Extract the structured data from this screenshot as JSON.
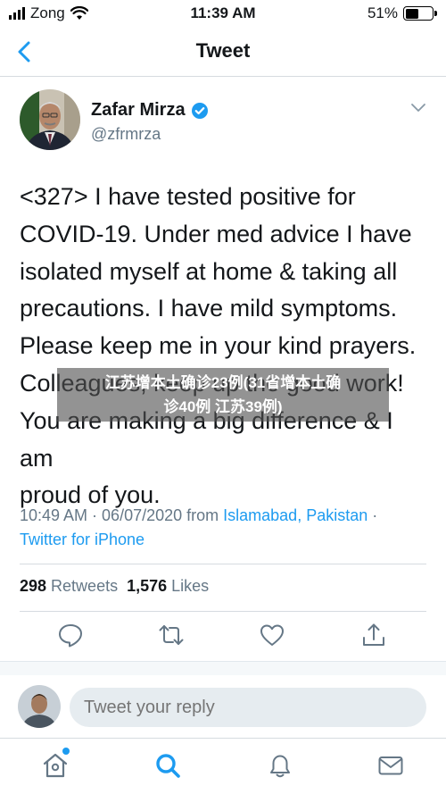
{
  "status_bar": {
    "carrier": "Zong",
    "time": "11:39 AM",
    "battery_percent": "51%",
    "battery_level": 0.51
  },
  "nav": {
    "title": "Tweet"
  },
  "author": {
    "name": "Zafar Mirza",
    "handle": "@zfrmrza",
    "verified": true
  },
  "tweet": {
    "text": "<327> I have tested positive for\nCOVID-19. Under med advice I have\nisolated myself at home & taking all\nprecautions. I have mild symptoms.\nPlease keep me in your kind prayers.\nColleagues, keep up the good work!\nYou are making a big difference & I am\nproud of you.",
    "timestamp": "10:49 AM · 06/07/2020 from ",
    "location": "Islamabad, Pakistan",
    "separator": " ·",
    "source": "Twitter for iPhone"
  },
  "overlay": {
    "line1": "江苏增本土确诊23例(31省增本土确",
    "line2": "诊40例 江苏39例)"
  },
  "stats": {
    "retweets_count": "298",
    "retweets_label": " Retweets",
    "likes_count": "1,576",
    "likes_label": " Likes"
  },
  "reply": {
    "placeholder": "Tweet your reply"
  },
  "colors": {
    "accent": "#1d9bf0",
    "text": "#14171a",
    "secondary": "#657786"
  },
  "icons": {
    "back": "chevron-left-icon",
    "caret": "chevron-down-icon",
    "reply": "comment-icon",
    "retweet": "retweet-icon",
    "like": "heart-icon",
    "share": "share-icon",
    "home": "home-icon",
    "search": "search-icon",
    "notifications": "bell-icon",
    "messages": "mail-icon"
  }
}
